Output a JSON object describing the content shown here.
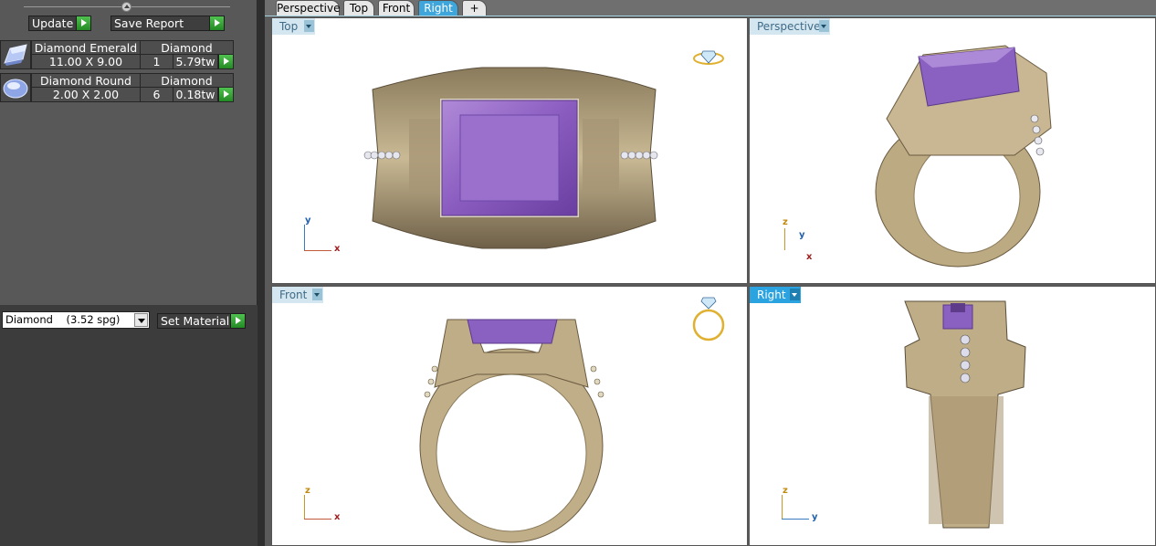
{
  "toolbar": {
    "update_label": "Update",
    "save_report_label": "Save Report"
  },
  "gems": [
    {
      "shape": "Diamond Emerald",
      "material": "Diamond",
      "size": "11.00 X 9.00",
      "count": "1",
      "weight": "5.79tw",
      "thumb_icon": "emerald-cut-gem-icon"
    },
    {
      "shape": "Diamond Round",
      "material": "Diamond",
      "size": "2.00 X 2.00",
      "count": "6",
      "weight": "0.18tw",
      "thumb_icon": "round-gem-icon"
    }
  ],
  "material": {
    "selected": "Diamond    (3.52 spg)",
    "set_label": "Set Material"
  },
  "tabs": [
    {
      "label": "Perspective",
      "active": false
    },
    {
      "label": "Top",
      "active": false
    },
    {
      "label": "Front",
      "active": false
    },
    {
      "label": "Right",
      "active": true
    },
    {
      "label": "+",
      "active": false
    }
  ],
  "viewports": {
    "top": {
      "label": "Top",
      "axes": [
        "x",
        "y"
      ]
    },
    "perspective": {
      "label": "Perspective",
      "axes": [
        "x",
        "y",
        "z"
      ]
    },
    "front": {
      "label": "Front",
      "axes": [
        "x",
        "z"
      ]
    },
    "right": {
      "label": "Right",
      "axes": [
        "y",
        "z"
      ]
    }
  },
  "colors": {
    "gold": "#bfae8a",
    "amethyst": "#8e63b8",
    "active_blue": "#2aa3e0"
  }
}
